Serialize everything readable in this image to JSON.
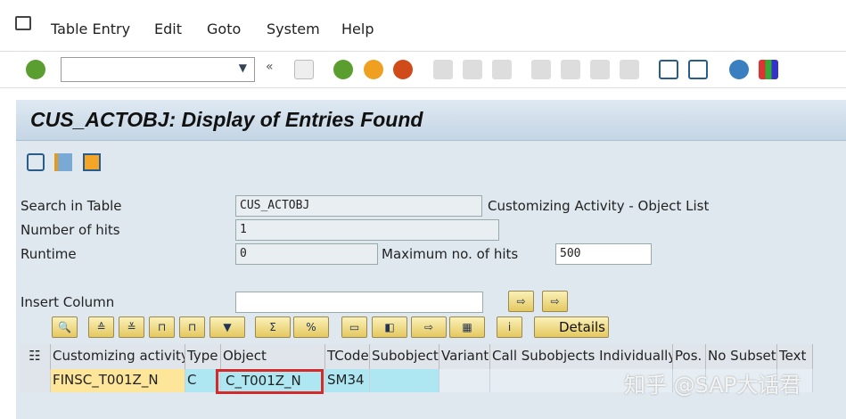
{
  "menu": {
    "items": [
      "Table Entry",
      "Edit",
      "Goto",
      "System",
      "Help"
    ]
  },
  "toolbar": {
    "command_value": ""
  },
  "title": "CUS_ACTOBJ: Display of Entries Found",
  "form": {
    "search_in_table_label": "Search in Table",
    "search_in_table_value": "CUS_ACTOBJ",
    "table_desc": "Customizing Activity - Object List",
    "hits_label": "Number of hits",
    "hits_value": "1",
    "runtime_label": "Runtime",
    "runtime_value": "0",
    "max_hits_label": "Maximum no. of hits",
    "max_hits_value": "500",
    "insert_column_label": "Insert Column",
    "insert_column_value": ""
  },
  "alv": {
    "details_label": "Details",
    "columns": [
      "Customizing activity",
      "Type",
      "Object",
      "TCode",
      "Subobject",
      "Variant",
      "Call Subobjects Individually",
      "Pos.",
      "No Subset",
      "Text"
    ],
    "rows": [
      [
        "FINSC_T001Z_N",
        "C",
        "C_T001Z_N",
        "SM34",
        "",
        "",
        "",
        "",
        "",
        ""
      ]
    ]
  },
  "watermark": "知乎 @SAP大话君",
  "colors": {
    "key": "#fde59a",
    "cell": "#aee7f2",
    "highlight": "#d42a2a"
  }
}
